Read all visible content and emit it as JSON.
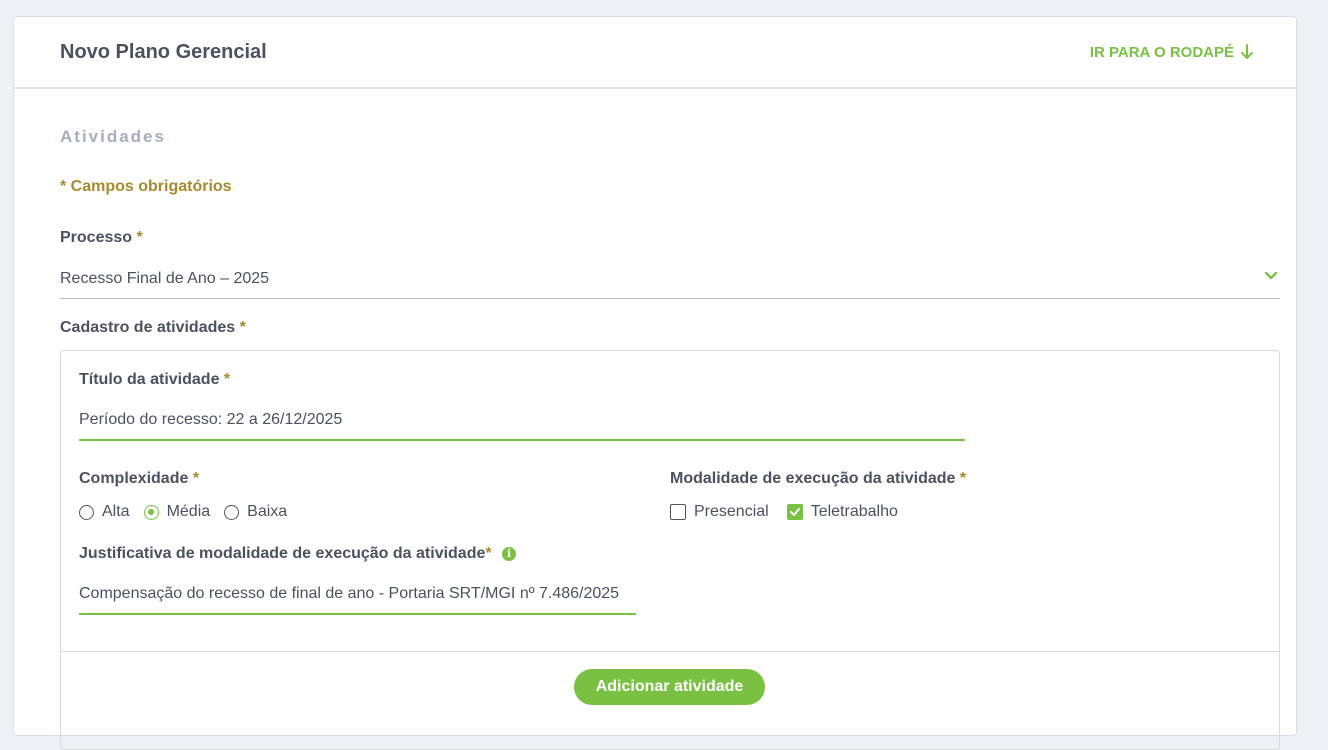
{
  "header": {
    "title": "Novo Plano Gerencial",
    "footer_link": "IR PARA O RODAPÉ",
    "footer_icon": "arrow-down-icon"
  },
  "section": {
    "title": "Atividades",
    "required_note": "* Campos obrigatórios"
  },
  "processo": {
    "label": "Processo",
    "required_mark": "*",
    "value": "Recesso Final de Ano – 2025",
    "icon": "chevron-down-icon"
  },
  "cadastro": {
    "label": "Cadastro de atividades",
    "required_mark": "*",
    "titulo": {
      "label": "Título da atividade",
      "required_mark": "*",
      "value": "Período do recesso: 22 a 26/12/2025"
    },
    "complexidade": {
      "label": "Complexidade",
      "required_mark": "*",
      "options": [
        "Alta",
        "Média",
        "Baixa"
      ],
      "selected": "Média"
    },
    "modalidade": {
      "label": "Modalidade de execução da atividade",
      "required_mark": "*",
      "options": [
        {
          "label": "Presencial",
          "checked": false
        },
        {
          "label": "Teletrabalho",
          "checked": true
        }
      ]
    },
    "justificativa": {
      "label": "Justificativa de modalidade de execução da atividade",
      "required_mark": "*",
      "info_icon": "info-icon",
      "value": "Compensação do recesso de final de ano - Portaria SRT/MGI nº 7.486/2025"
    },
    "add_button": "Adicionar atividade"
  },
  "colors": {
    "accent": "#7ac143",
    "required": "#a88a2c",
    "section_title": "#a4afbd"
  }
}
